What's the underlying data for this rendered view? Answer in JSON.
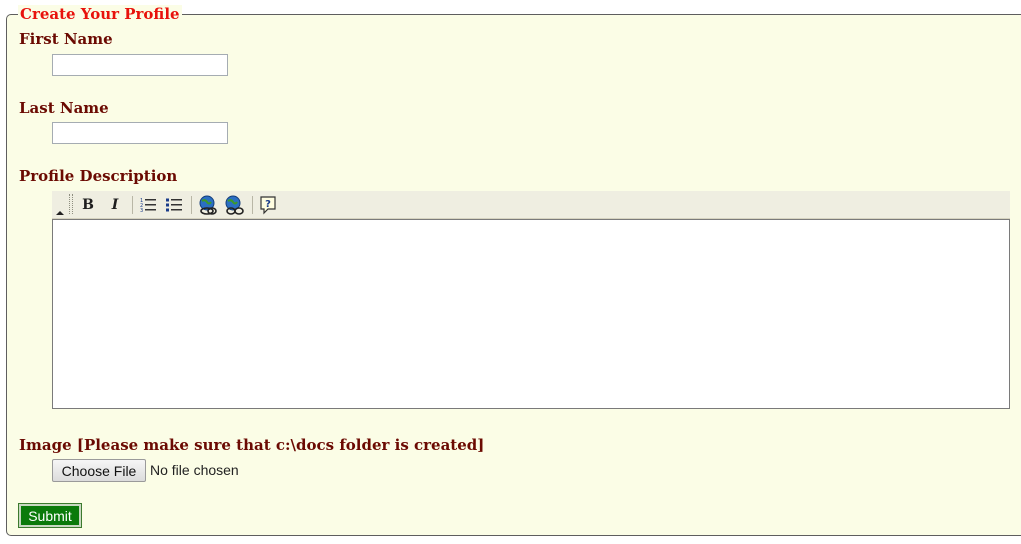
{
  "form": {
    "legend": "Create Your Profile",
    "first_name": {
      "label": "First Name",
      "value": ""
    },
    "last_name": {
      "label": "Last Name",
      "value": ""
    },
    "description": {
      "label": "Profile Description",
      "toolbar": [
        {
          "name": "collapse-toolbar",
          "icon": "triangle-up-icon"
        },
        {
          "name": "bold",
          "icon": "bold-icon",
          "glyph": "B"
        },
        {
          "name": "italic",
          "icon": "italic-icon",
          "glyph": "I"
        },
        {
          "name": "numbered-list",
          "icon": "numbered-list-icon"
        },
        {
          "name": "bulleted-list",
          "icon": "bulleted-list-icon"
        },
        {
          "name": "link",
          "icon": "link-icon"
        },
        {
          "name": "unlink",
          "icon": "unlink-icon"
        },
        {
          "name": "about",
          "icon": "help-icon",
          "glyph": "?"
        }
      ],
      "content": ""
    },
    "image": {
      "label": "Image [Please make sure that c:\\docs folder is created]",
      "button_label": "Choose File",
      "status": "No file chosen"
    },
    "submit_label": "Submit"
  },
  "colors": {
    "legend": "#e8120c",
    "label": "#6b0a02",
    "panel_background": "#fbfde6",
    "submit_background": "#0b7a0b"
  }
}
